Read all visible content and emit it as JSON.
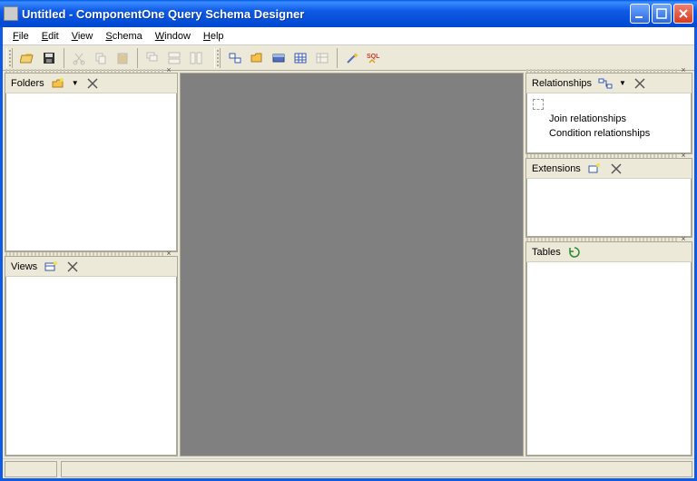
{
  "title": "Untitled - ComponentOne Query Schema Designer",
  "menus": [
    "File",
    "Edit",
    "View",
    "Schema",
    "Window",
    "Help"
  ],
  "toolbar": {
    "open": "open",
    "save": "save",
    "cut": "cut",
    "copy": "copy",
    "paste": "paste",
    "cascade": "cascade",
    "tile_h": "tile-horizontal",
    "tile_v": "tile-vertical",
    "grp1": "g1",
    "grp2": "g2",
    "grp3": "g3",
    "grp4": "g4",
    "grp5": "g5",
    "wizard": "wizard",
    "sql": "sql"
  },
  "panels": {
    "folders": {
      "label": "Folders"
    },
    "views": {
      "label": "Views"
    },
    "relationships": {
      "label": "Relationships",
      "items": [
        "Join relationships",
        "Condition relationships"
      ]
    },
    "extensions": {
      "label": "Extensions"
    },
    "tables": {
      "label": "Tables"
    }
  },
  "window_buttons": {
    "min": "_",
    "max": "□",
    "close": "×"
  },
  "statusbar": {
    "cell1": "",
    "cell2": ""
  }
}
